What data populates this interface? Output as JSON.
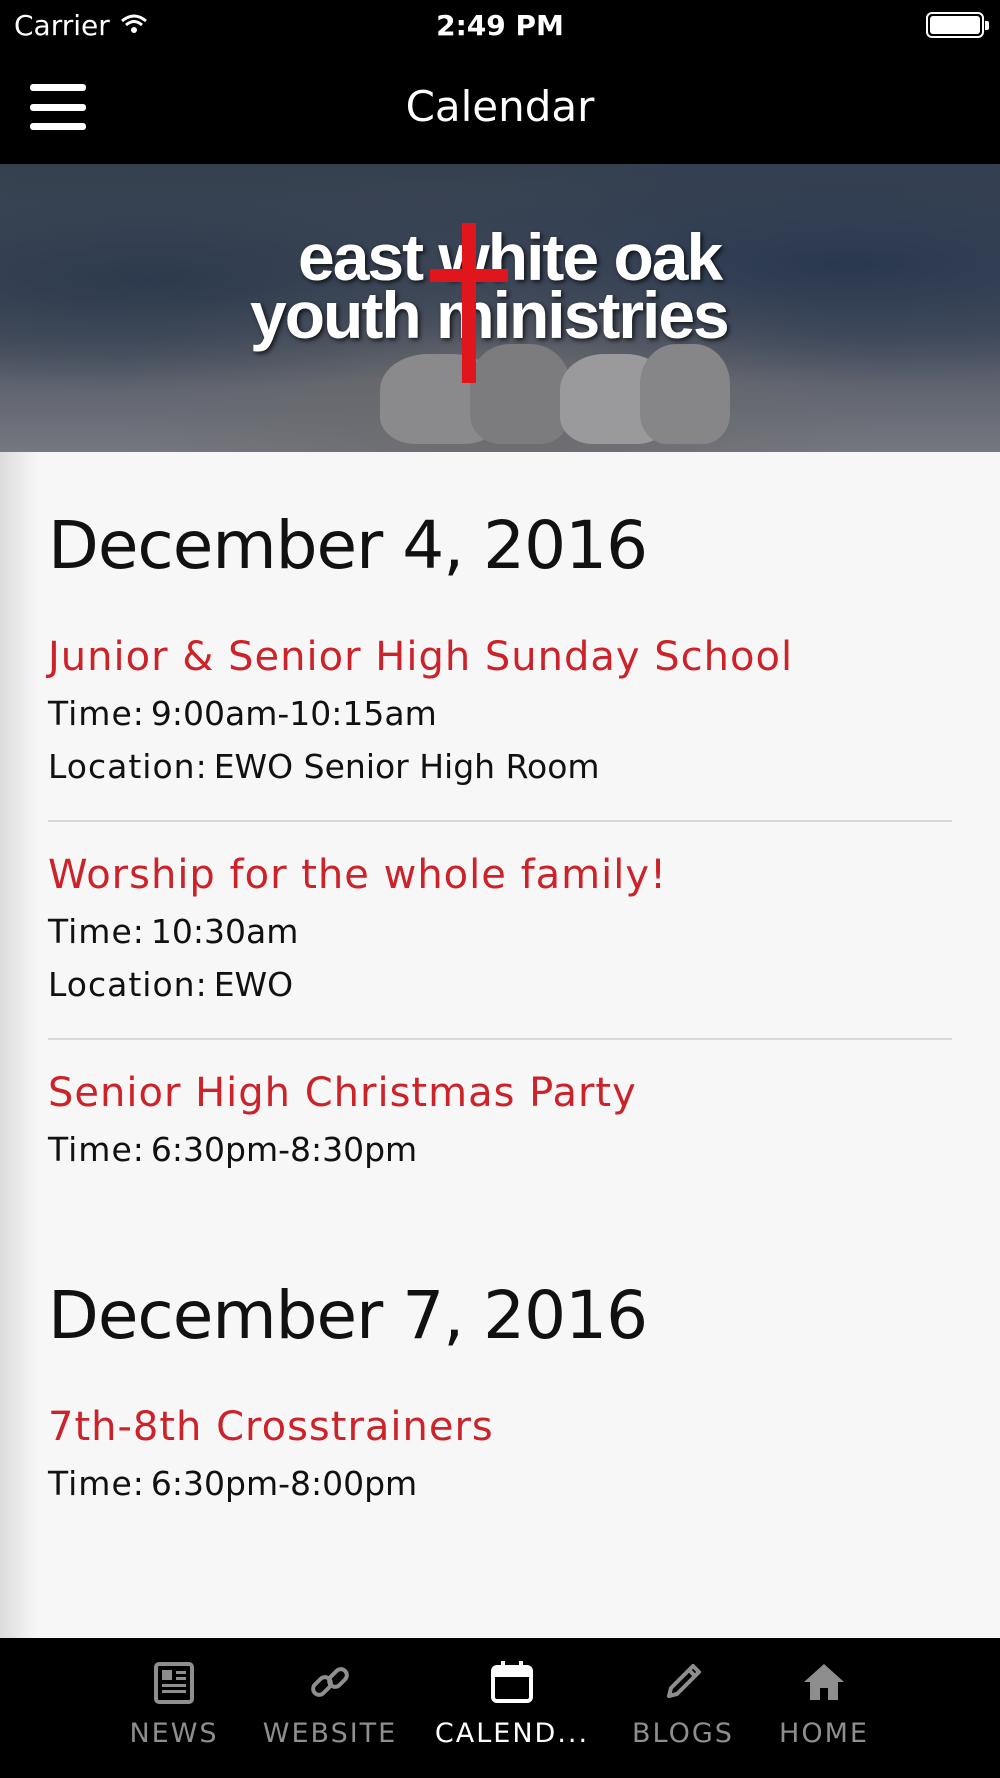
{
  "status_bar": {
    "carrier": "Carrier",
    "time": "2:49 PM"
  },
  "nav": {
    "title": "Calendar",
    "menu_icon": "hamburger-icon"
  },
  "banner": {
    "line1": "east white oak",
    "line2": "youth ministries"
  },
  "days": [
    {
      "date": "December 4, 2016",
      "events": [
        {
          "title": "Junior & Senior High Sunday School",
          "time_label": "Time:",
          "time": "9:00am-10:15am",
          "location_label": "Location:",
          "location": "EWO Senior High Room"
        },
        {
          "title": "Worship for the whole family!",
          "time_label": "Time:",
          "time": "10:30am",
          "location_label": "Location:",
          "location": "EWO"
        },
        {
          "title": "Senior High Christmas Party",
          "time_label": "Time:",
          "time": "6:30pm-8:30pm"
        }
      ]
    },
    {
      "date": "December 7, 2016",
      "events": [
        {
          "title": "7th-8th Crosstrainers",
          "time_label": "Time:",
          "time": "6:30pm-8:00pm"
        }
      ]
    }
  ],
  "tabs": [
    {
      "label": "NEWS",
      "icon": "newspaper-icon",
      "active": false
    },
    {
      "label": "WEBSITE",
      "icon": "link-icon",
      "active": false
    },
    {
      "label": "CALEND...",
      "icon": "calendar-icon",
      "active": true
    },
    {
      "label": "BLOGS",
      "icon": "pencil-icon",
      "active": false
    },
    {
      "label": "HOME",
      "icon": "home-icon",
      "active": false
    }
  ],
  "colors": {
    "accent": "#cc2229",
    "tab_active": "#ffffff",
    "tab_inactive": "#8e8e8e"
  }
}
